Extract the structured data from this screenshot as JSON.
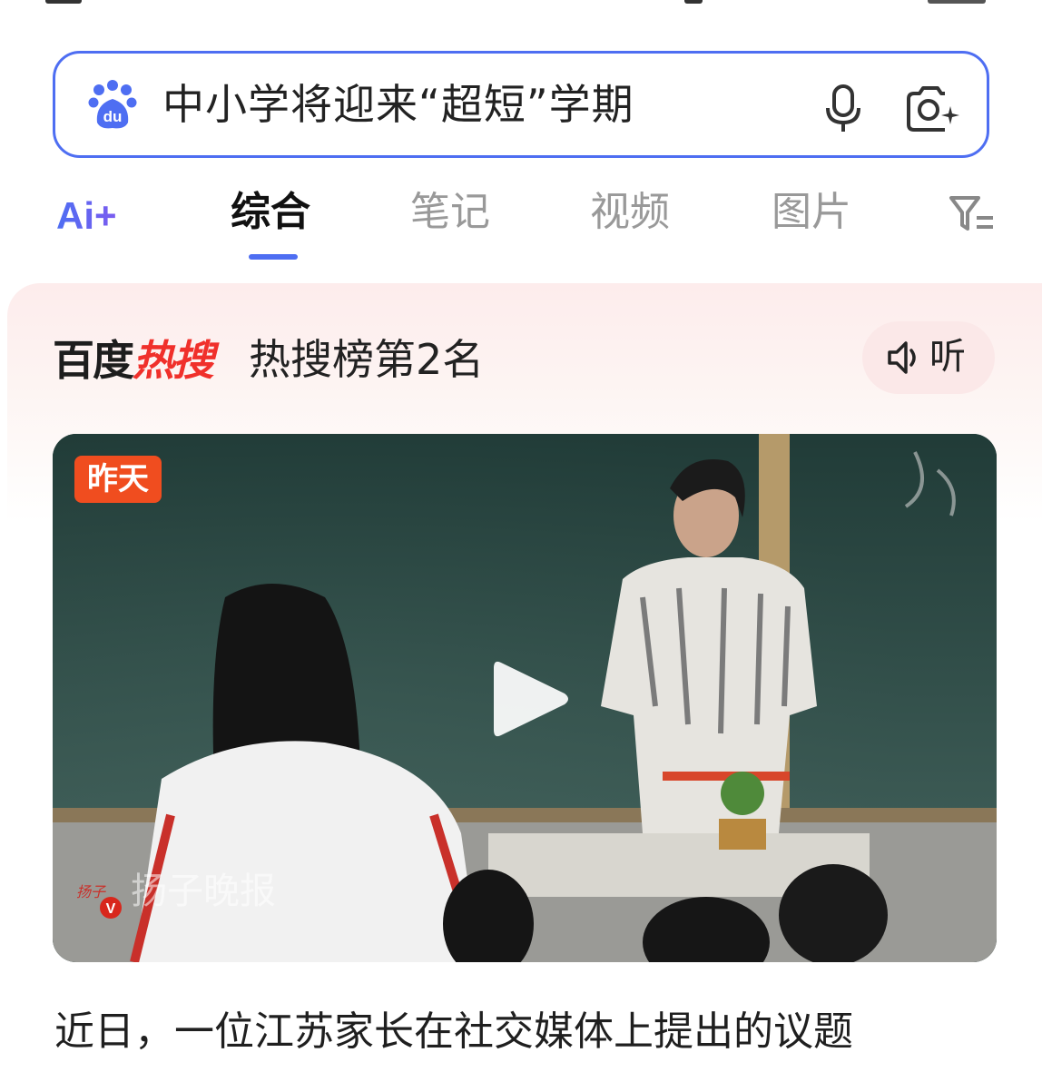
{
  "search": {
    "query": "中小学将迎来“超短”学期",
    "logo_icon": "baidu-paw-logo",
    "voice_icon": "microphone-icon",
    "image_search_icon": "camera-sparkle-icon",
    "accent_color": "#4e6ef2"
  },
  "tabs": {
    "ai_label": "Ai+",
    "items": [
      {
        "label": "综合",
        "active": true
      },
      {
        "label": "笔记",
        "active": false
      },
      {
        "label": "视频",
        "active": false
      },
      {
        "label": "图片",
        "active": false
      }
    ],
    "filter_icon": "filter-icon"
  },
  "hot": {
    "brand_black": "百度",
    "brand_red": "热搜",
    "rank_text": "热搜榜第2名",
    "listen_label": "听",
    "brand_red_color": "#f0302b"
  },
  "video": {
    "badge": "昨天",
    "badge_color": "#f04d1f",
    "watermark": "扬子晚报",
    "play_icon": "play-icon"
  },
  "article": {
    "snippet": "近日，一位江苏家长在社交媒体上提出的议题"
  }
}
